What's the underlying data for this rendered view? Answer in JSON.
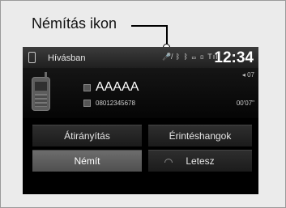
{
  "callout": {
    "label": "Némítás ikon"
  },
  "status_bar": {
    "title": "Hívásban",
    "icons_text": "🎤̸ ᛒ ᛒ ▭ ▯ Tıl",
    "clock": "12:34"
  },
  "call": {
    "contact_name": "AAAAA",
    "contact_number": "08012345678",
    "volume_text": "◂ 07",
    "duration": "00'07\""
  },
  "buttons": {
    "transfer": "Átirányítás",
    "touch_tones": "Érintéshangok",
    "mute": "Némít",
    "hang_up": "Letesz"
  }
}
